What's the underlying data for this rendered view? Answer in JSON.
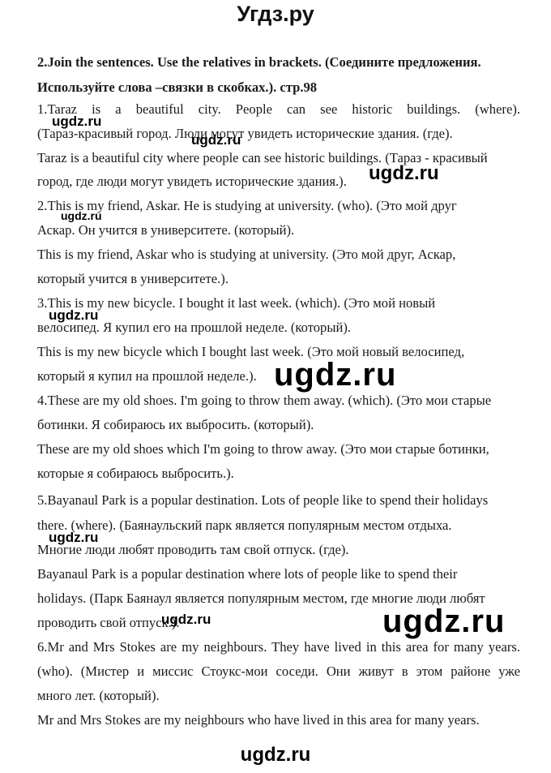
{
  "site_title": "Угдз.ру",
  "task": {
    "heading_line1": "2.Join the sentences. Use the relatives in brackets. (Соедините предложения.",
    "heading_line2": "Используйте слова –связки в скобках.). стр.98"
  },
  "lines": [
    "1.Taraz is a beautiful city. People can see historic buildings. (where).",
    "(Тараз-красивый город. Люди могут увидеть исторические здания. (где).",
    "Taraz is a beautiful city where people can see historic buildings. (Тараз - красивый",
    "город, где люди могут увидеть исторические здания.).",
    "2.This is my friend, Askar. He is studying at university. (who). (Это мой друг",
    "Аскар. Он учится в университете. (который).",
    "This is my friend, Askar who is studying at university. (Это мой друг, Аскар,",
    "который учится в университете.).",
    "3.This is my new bicycle. I bought it last week. (which). (Это мой новый",
    "велосипед. Я купил его на прошлой неделе. (который).",
    "This is my new bicycle which  I bought last week. (Это мой новый велосипед,",
    "который я купил на прошлой неделе.).",
    "4.These are my old shoes. I'm going to throw them away. (which). (Это мои старые",
    "ботинки. Я собираюсь их выбросить. (который).",
    "These are my old shoes which I'm going to throw away. (Это мои старые ботинки,",
    "которые я собираюсь выбросить.).",
    "5.Bayanaul Park is a popular destination. Lots of people like to spend their holidays",
    "there. (where). (Баянаульский парк является популярным местом отдыха.",
    "Многие люди любят проводить там свой отпуск. (где).",
    "Bayanaul Park is a popular destination where lots of people like to spend their",
    "holidays. (Парк Баянаул является популярным местом, где многие люди любят",
    "проводить свой отпуск.).",
    "6.Mr and Mrs Stokes are my neighbours. They have lived in this area for many years.",
    "(who). (Мистер и миссис Стоукс-мои соседи. Они живут в этом районе уже",
    "много лет. (который).",
    "Mr and Mrs Stokes are my neighbours who have lived in this area for many years."
  ],
  "watermark": "ugdz.ru"
}
